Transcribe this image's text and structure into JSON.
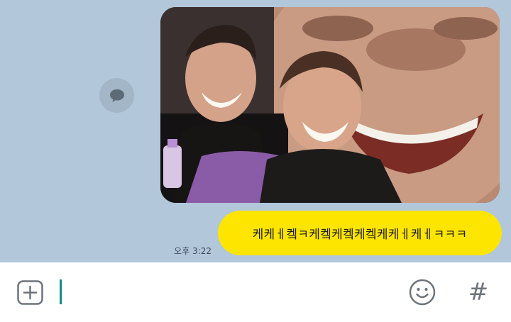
{
  "chat": {
    "share_icon": "speech-bubble-icon",
    "photo": {
      "description_icon": "photo-message"
    },
    "message": {
      "text": "케케ㅔ켘ㅋ케켘케켘케켘케케ㅔ케ㅔㅋㅋㅋ",
      "time": "오후 3:22",
      "bubble_color": "#fee500"
    }
  },
  "input_bar": {
    "add_icon": "plus-square-icon",
    "emoji_icon": "smiley-icon",
    "hashtag_icon": "hash-icon",
    "hash_glyph": "#",
    "input_value": "",
    "caret_color": "#0f8f80"
  },
  "colors": {
    "chat_background": "#b2c7da",
    "input_background": "#ffffff"
  }
}
